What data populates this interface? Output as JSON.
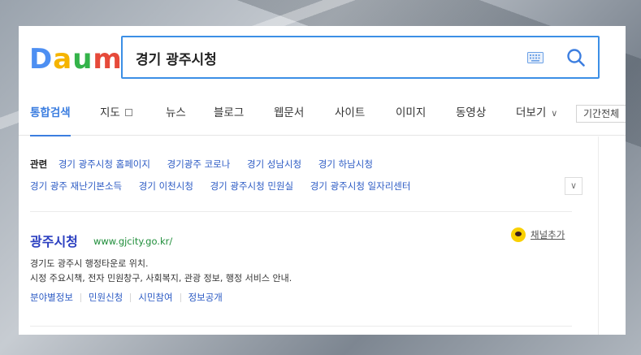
{
  "logo": {
    "letters": [
      "D",
      "a",
      "u",
      "m"
    ],
    "colors": [
      "#4d8ff2",
      "#f5b400",
      "#34b34a",
      "#e64a3a"
    ]
  },
  "search": {
    "query": "경기 광주시청"
  },
  "icons": {
    "keyboard": "keyboard-icon",
    "search": "search-icon",
    "channel": "kakao-channel-icon"
  },
  "tabs": [
    {
      "label": "통합검색",
      "active": true
    },
    {
      "label": "지도"
    },
    {
      "label": "뉴스"
    },
    {
      "label": "블로그"
    },
    {
      "label": "웹문서"
    },
    {
      "label": "사이트"
    },
    {
      "label": "이미지"
    },
    {
      "label": "동영상"
    },
    {
      "label": "더보기"
    }
  ],
  "period": "기간전체",
  "related": {
    "title": "관련",
    "row1": [
      "경기 광주시청 홈페이지",
      "경기광주 코로나",
      "경기 성남시청",
      "경기 하남시청"
    ],
    "row2": [
      "경기 광주 재난기본소득",
      "경기 이천시청",
      "경기 광주시청 민원실",
      "경기 광주시청 일자리센터"
    ],
    "toggle": "∨"
  },
  "result": {
    "title": "광주시청",
    "url": "www.gjcity.go.kr/",
    "channel": "채널추가",
    "desc1": "경기도 광주시 행정타운로 위치.",
    "desc2": "시정 주요시책, 전자 민원창구, 사회복지, 관광 정보, 행정 서비스 안내.",
    "links": [
      "분야별정보",
      "민원신청",
      "시민참여",
      "정보공개"
    ]
  },
  "accent": "#3c7ee0"
}
